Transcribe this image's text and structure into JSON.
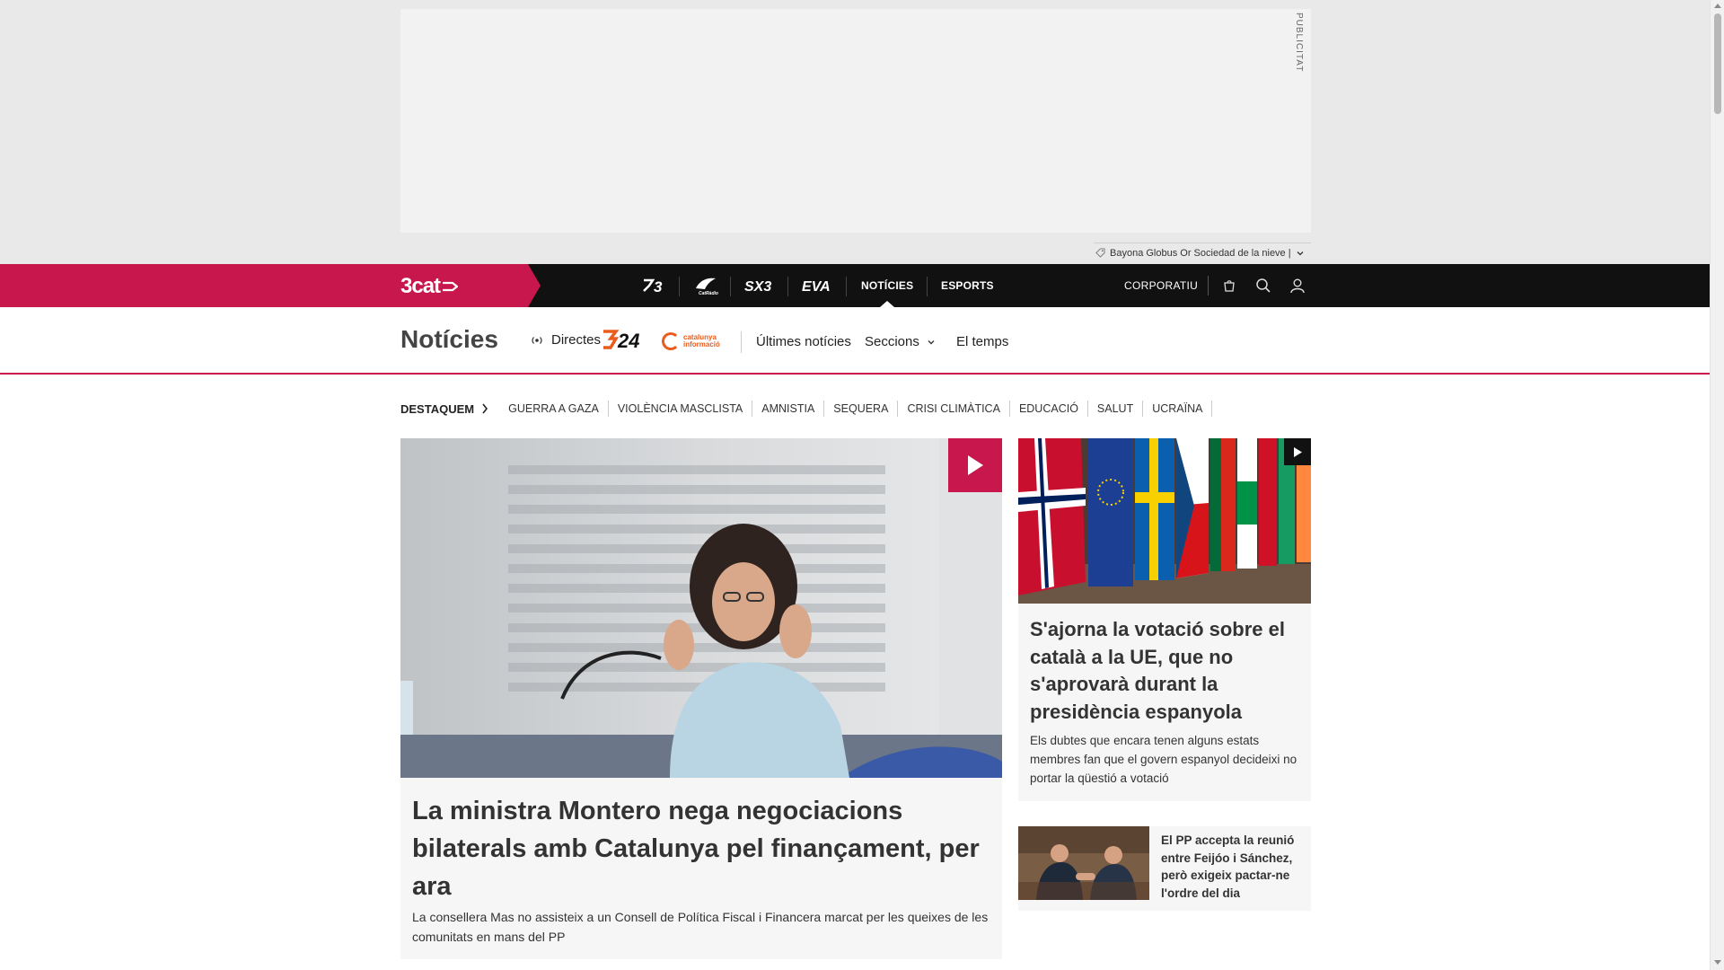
{
  "ad": {
    "label": "PUBLICITAT",
    "sponsor": "Bayona Globus Or Sociedad de la nieve |"
  },
  "nav": {
    "brand": "3cat",
    "channels": [
      {
        "label": "3",
        "icon": "tv3-logo-icon"
      },
      {
        "label": "Cat Ràdio",
        "icon": "catradio-logo-icon"
      },
      {
        "label": "SX3",
        "icon": "sx3-logo-icon"
      },
      {
        "label": "EVA",
        "icon": "eva-logo-icon"
      }
    ],
    "sections": [
      "NOTÍCIES",
      "ESPORTS"
    ],
    "active": "NOTÍCIES",
    "corporate": "CORPORATIU",
    "icons": [
      "shopping-bag-icon",
      "search-icon",
      "user-icon"
    ]
  },
  "section": {
    "title": "Notícies",
    "live": "Directes",
    "logo_324": "324",
    "logo_ci": "catalunya informació",
    "links": [
      "Últimes notícies",
      "Seccions",
      "El temps"
    ]
  },
  "tags": {
    "lead": "DESTAQUEM",
    "items": [
      "GUERRA A GAZA",
      "VIOLÈNCIA MASCLISTA",
      "AMNISTIA",
      "SEQUERA",
      "CRISI CLIMÀTICA",
      "EDUCACIÓ",
      "SALUT",
      "UCRAÏNA"
    ]
  },
  "articles": {
    "main": {
      "title": "La ministra Montero nega negociacions bilaterals amb Catalunya pel finançament, per ara",
      "subtitle": "La consellera Mas no assisteix a un Consell de Política Fiscal i Financera marcat per les queixes de les comunitats en mans del PP"
    },
    "side": {
      "title": "S'ajorna la votació sobre el català a la UE, que no s'aprovarà durant la presidència espanyola",
      "subtitle": "Els dubtes que encara tenen alguns estats membres fan que el govern espanyol decideixi no portar la qüestió a votació"
    },
    "small": {
      "title": "El PP accepta la reunió entre Feijóo i Sánchez, però exigeix pactar-ne l'ordre del dia"
    }
  },
  "colors": {
    "brand": "#c8174c",
    "nav_bg": "#111111",
    "accent_orange": "#e85d1d"
  }
}
